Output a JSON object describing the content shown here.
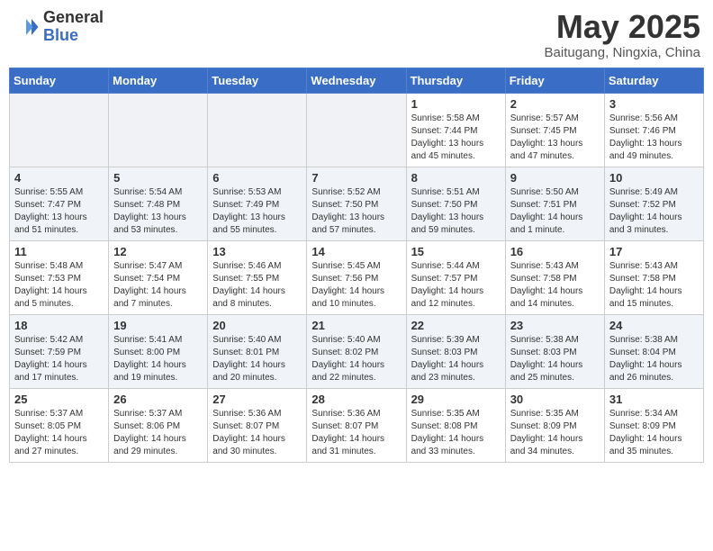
{
  "header": {
    "logo_general": "General",
    "logo_blue": "Blue",
    "month_title": "May 2025",
    "location": "Baitugang, Ningxia, China"
  },
  "days_of_week": [
    "Sunday",
    "Monday",
    "Tuesday",
    "Wednesday",
    "Thursday",
    "Friday",
    "Saturday"
  ],
  "weeks": [
    [
      {
        "day": "",
        "detail": ""
      },
      {
        "day": "",
        "detail": ""
      },
      {
        "day": "",
        "detail": ""
      },
      {
        "day": "",
        "detail": ""
      },
      {
        "day": "1",
        "detail": "Sunrise: 5:58 AM\nSunset: 7:44 PM\nDaylight: 13 hours\nand 45 minutes."
      },
      {
        "day": "2",
        "detail": "Sunrise: 5:57 AM\nSunset: 7:45 PM\nDaylight: 13 hours\nand 47 minutes."
      },
      {
        "day": "3",
        "detail": "Sunrise: 5:56 AM\nSunset: 7:46 PM\nDaylight: 13 hours\nand 49 minutes."
      }
    ],
    [
      {
        "day": "4",
        "detail": "Sunrise: 5:55 AM\nSunset: 7:47 PM\nDaylight: 13 hours\nand 51 minutes."
      },
      {
        "day": "5",
        "detail": "Sunrise: 5:54 AM\nSunset: 7:48 PM\nDaylight: 13 hours\nand 53 minutes."
      },
      {
        "day": "6",
        "detail": "Sunrise: 5:53 AM\nSunset: 7:49 PM\nDaylight: 13 hours\nand 55 minutes."
      },
      {
        "day": "7",
        "detail": "Sunrise: 5:52 AM\nSunset: 7:50 PM\nDaylight: 13 hours\nand 57 minutes."
      },
      {
        "day": "8",
        "detail": "Sunrise: 5:51 AM\nSunset: 7:50 PM\nDaylight: 13 hours\nand 59 minutes."
      },
      {
        "day": "9",
        "detail": "Sunrise: 5:50 AM\nSunset: 7:51 PM\nDaylight: 14 hours\nand 1 minute."
      },
      {
        "day": "10",
        "detail": "Sunrise: 5:49 AM\nSunset: 7:52 PM\nDaylight: 14 hours\nand 3 minutes."
      }
    ],
    [
      {
        "day": "11",
        "detail": "Sunrise: 5:48 AM\nSunset: 7:53 PM\nDaylight: 14 hours\nand 5 minutes."
      },
      {
        "day": "12",
        "detail": "Sunrise: 5:47 AM\nSunset: 7:54 PM\nDaylight: 14 hours\nand 7 minutes."
      },
      {
        "day": "13",
        "detail": "Sunrise: 5:46 AM\nSunset: 7:55 PM\nDaylight: 14 hours\nand 8 minutes."
      },
      {
        "day": "14",
        "detail": "Sunrise: 5:45 AM\nSunset: 7:56 PM\nDaylight: 14 hours\nand 10 minutes."
      },
      {
        "day": "15",
        "detail": "Sunrise: 5:44 AM\nSunset: 7:57 PM\nDaylight: 14 hours\nand 12 minutes."
      },
      {
        "day": "16",
        "detail": "Sunrise: 5:43 AM\nSunset: 7:58 PM\nDaylight: 14 hours\nand 14 minutes."
      },
      {
        "day": "17",
        "detail": "Sunrise: 5:43 AM\nSunset: 7:58 PM\nDaylight: 14 hours\nand 15 minutes."
      }
    ],
    [
      {
        "day": "18",
        "detail": "Sunrise: 5:42 AM\nSunset: 7:59 PM\nDaylight: 14 hours\nand 17 minutes."
      },
      {
        "day": "19",
        "detail": "Sunrise: 5:41 AM\nSunset: 8:00 PM\nDaylight: 14 hours\nand 19 minutes."
      },
      {
        "day": "20",
        "detail": "Sunrise: 5:40 AM\nSunset: 8:01 PM\nDaylight: 14 hours\nand 20 minutes."
      },
      {
        "day": "21",
        "detail": "Sunrise: 5:40 AM\nSunset: 8:02 PM\nDaylight: 14 hours\nand 22 minutes."
      },
      {
        "day": "22",
        "detail": "Sunrise: 5:39 AM\nSunset: 8:03 PM\nDaylight: 14 hours\nand 23 minutes."
      },
      {
        "day": "23",
        "detail": "Sunrise: 5:38 AM\nSunset: 8:03 PM\nDaylight: 14 hours\nand 25 minutes."
      },
      {
        "day": "24",
        "detail": "Sunrise: 5:38 AM\nSunset: 8:04 PM\nDaylight: 14 hours\nand 26 minutes."
      }
    ],
    [
      {
        "day": "25",
        "detail": "Sunrise: 5:37 AM\nSunset: 8:05 PM\nDaylight: 14 hours\nand 27 minutes."
      },
      {
        "day": "26",
        "detail": "Sunrise: 5:37 AM\nSunset: 8:06 PM\nDaylight: 14 hours\nand 29 minutes."
      },
      {
        "day": "27",
        "detail": "Sunrise: 5:36 AM\nSunset: 8:07 PM\nDaylight: 14 hours\nand 30 minutes."
      },
      {
        "day": "28",
        "detail": "Sunrise: 5:36 AM\nSunset: 8:07 PM\nDaylight: 14 hours\nand 31 minutes."
      },
      {
        "day": "29",
        "detail": "Sunrise: 5:35 AM\nSunset: 8:08 PM\nDaylight: 14 hours\nand 33 minutes."
      },
      {
        "day": "30",
        "detail": "Sunrise: 5:35 AM\nSunset: 8:09 PM\nDaylight: 14 hours\nand 34 minutes."
      },
      {
        "day": "31",
        "detail": "Sunrise: 5:34 AM\nSunset: 8:09 PM\nDaylight: 14 hours\nand 35 minutes."
      }
    ]
  ]
}
